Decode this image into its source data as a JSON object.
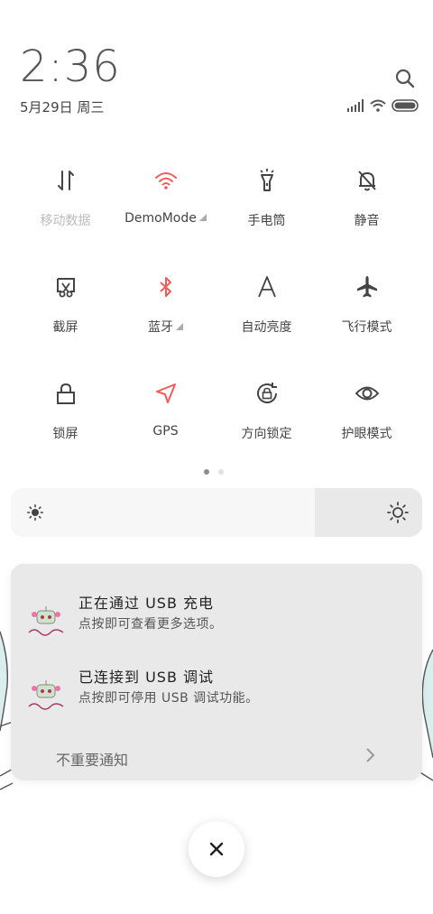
{
  "status_bar": {
    "time": "2:36",
    "date": "5月29日 周三"
  },
  "quick_settings": {
    "tiles": [
      {
        "label": "移动数据",
        "icon": "mobile-data-icon",
        "active": false,
        "disabled": true
      },
      {
        "label": "DemoMode",
        "icon": "wifi-icon",
        "active": true,
        "has_more": true
      },
      {
        "label": "手电筒",
        "icon": "flashlight-icon",
        "active": false
      },
      {
        "label": "静音",
        "icon": "mute-bell-icon",
        "active": false
      },
      {
        "label": "截屏",
        "icon": "screenshot-icon",
        "active": false
      },
      {
        "label": "蓝牙",
        "icon": "bluetooth-icon",
        "active": true,
        "has_more": true
      },
      {
        "label": "自动亮度",
        "icon": "auto-brightness-icon",
        "active": false
      },
      {
        "label": "飞行模式",
        "icon": "airplane-icon",
        "active": false
      },
      {
        "label": "锁屏",
        "icon": "lock-icon",
        "active": false
      },
      {
        "label": "GPS",
        "icon": "gps-icon",
        "active": true
      },
      {
        "label": "方向锁定",
        "icon": "rotation-lock-icon",
        "active": false
      },
      {
        "label": "护眼模式",
        "icon": "eye-icon",
        "active": false
      }
    ],
    "page_count": 2,
    "current_page": 1
  },
  "brightness": {
    "level_percent": 74
  },
  "notifications": [
    {
      "title": "正在通过 USB 充电",
      "subtitle": "点按即可查看更多选项。",
      "app_icon": "app-logo-icon"
    },
    {
      "title": "已连接到 USB 调试",
      "subtitle": "点按即可停用 USB 调试功能。",
      "app_icon": "app-logo-icon"
    }
  ],
  "less_important": {
    "label": "不重要通知"
  },
  "colors": {
    "active": "#f25b5b",
    "icon": "#444444",
    "disabled": "#bbbbbb"
  }
}
